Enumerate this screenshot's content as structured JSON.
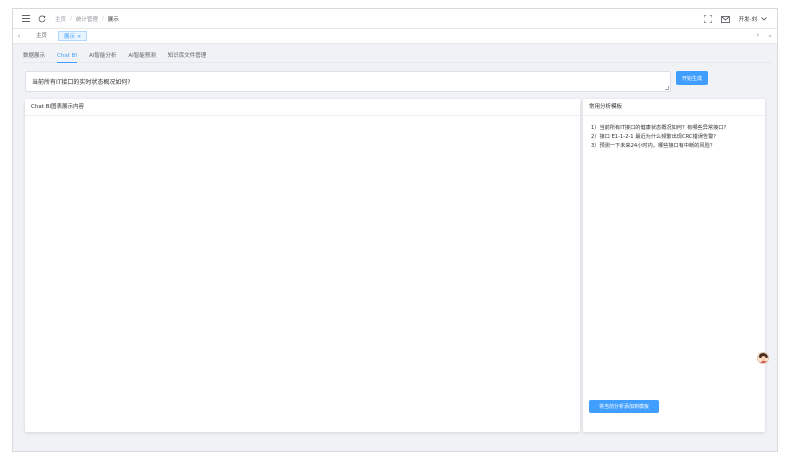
{
  "breadcrumb": [
    "主页",
    "统计管理",
    "展示"
  ],
  "user": {
    "name": "开发-刘"
  },
  "tags": {
    "home": "主页",
    "active": "展示",
    "close": "×"
  },
  "subtabs": [
    "数据展示",
    "Chat BI",
    "AI智能分析",
    "AI智能预测",
    "知识库文件管理"
  ],
  "question": {
    "value": "当前所有IT接口的实时状态概况如何?"
  },
  "generate_button": "开始生成",
  "left_panel": {
    "title": "Chat BI图表展示内容"
  },
  "right_panel": {
    "title": "常用分析模板",
    "items": [
      "1）当前所有IT接口的健康状态概况如何？有哪些异常接口？",
      "2）接口 E1-1-2-1 最近为什么频繁出现CRC错误告警？",
      "3）预测一下未来24小时内，哪些接口有中断的风险？"
    ],
    "add_button": "将当前分析添加到模板"
  },
  "colors": {
    "primary": "#409eff",
    "background": "#f0f2f5"
  }
}
